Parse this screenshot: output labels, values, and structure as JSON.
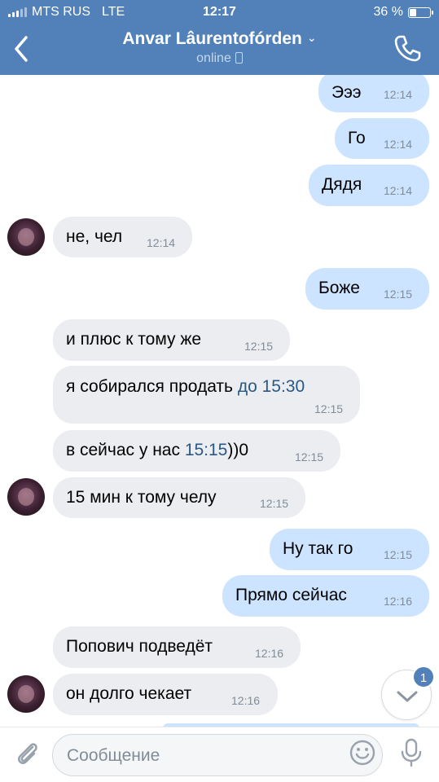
{
  "status_bar": {
    "carrier": "MTS RUS",
    "network": "LTE",
    "time": "12:17",
    "battery": "36 %",
    "battery_level": 0.36
  },
  "header": {
    "title": "Anvar Lâurentofórden",
    "subtitle": "online"
  },
  "messages": [
    {
      "dir": "out",
      "text": "Эээ",
      "time": "12:14"
    },
    {
      "dir": "out",
      "text": "Го",
      "time": "12:14"
    },
    {
      "dir": "out",
      "text": "Дядя",
      "time": "12:14"
    },
    {
      "dir": "in",
      "text": "не, чел",
      "time": "12:14",
      "avatar": true
    },
    {
      "dir": "out",
      "text": "Боже",
      "time": "12:15"
    },
    {
      "dir": "in",
      "text": "и плюс к тому же",
      "time": "12:15"
    },
    {
      "dir": "in",
      "text": "я собирался продать ",
      "link": "до 15:30",
      "time": "12:15"
    },
    {
      "dir": "in",
      "text": "в сейчас у нас ",
      "link": "15:15",
      "text_after": "))0",
      "time": "12:15"
    },
    {
      "dir": "in",
      "text": "15 мин к тому челу",
      "time": "12:15",
      "avatar": true
    },
    {
      "dir": "out",
      "text": "Ну так го",
      "time": "12:15"
    },
    {
      "dir": "out",
      "text": "Прямо сейчас",
      "time": "12:16"
    },
    {
      "dir": "in",
      "text": "Попович подведёт",
      "time": "12:16"
    },
    {
      "dir": "in",
      "text": "он долго чекает",
      "time": "12:16",
      "avatar": true
    }
  ],
  "scroll_down": {
    "badge": "1"
  },
  "composer": {
    "placeholder": "Сообщение"
  },
  "colors": {
    "header": "#5181b8",
    "outgoing": "#cce4ff",
    "incoming": "#ebedf0",
    "link": "#2a5885",
    "time": "#818c99"
  }
}
